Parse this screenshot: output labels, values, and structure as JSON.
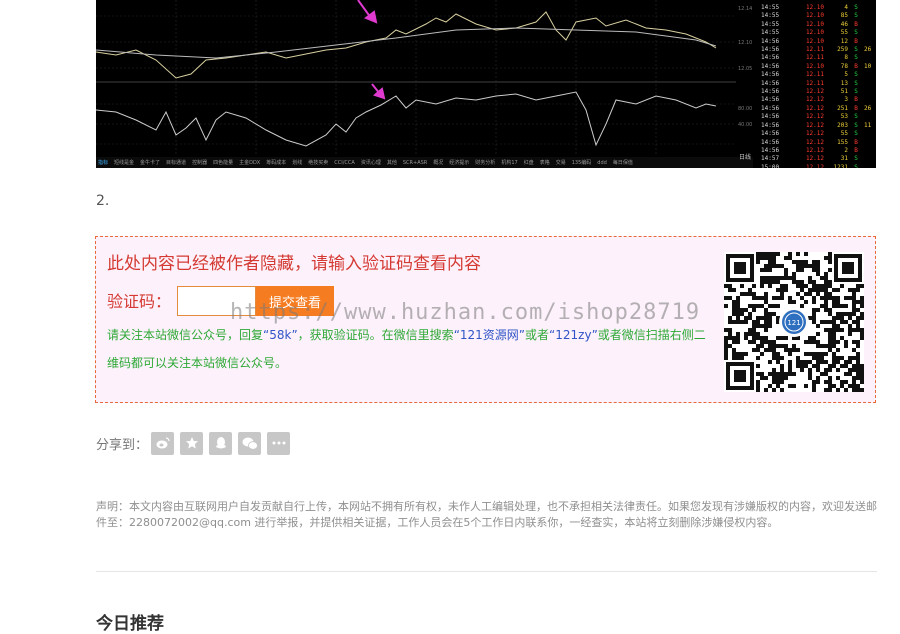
{
  "chart": {
    "times": [
      "14:55",
      "14:55",
      "14:55",
      "14:55",
      "14:56",
      "14:56",
      "14:56",
      "14:56",
      "14:56",
      "14:56",
      "14:56",
      "14:56",
      "14:56",
      "14:56",
      "14:56",
      "14:56",
      "14:56",
      "14:56",
      "14:57",
      "15:00"
    ],
    "prices": [
      "12.10",
      "12.10",
      "12.10",
      "12.10",
      "12.10",
      "12.11",
      "12.11",
      "12.10",
      "12.11",
      "12.11",
      "12.12",
      "12.12",
      "12.12",
      "12.12",
      "12.12",
      "12.12",
      "12.12",
      "12.12",
      "12.12",
      "12.12"
    ],
    "volumes": [
      "4",
      "85",
      "46",
      "55",
      "12",
      "259",
      "8",
      "78",
      "5",
      "13",
      "51",
      "3",
      "251",
      "53",
      "203",
      "55",
      "155",
      "2",
      "31",
      "1231"
    ],
    "directions": [
      "S",
      "S",
      "B",
      "S",
      "B",
      "S",
      "S",
      "B",
      "S",
      "S",
      "S",
      "B",
      "B",
      "S",
      "S",
      "S",
      "B",
      "B",
      "S",
      "S"
    ],
    "extra": [
      "",
      "",
      "",
      "",
      "",
      "26",
      "",
      "10",
      "",
      "",
      "",
      "",
      "26",
      "",
      "11",
      "",
      "",
      "",
      "",
      ""
    ],
    "tabs": [
      "指标",
      "短线是金",
      "金牛卡了",
      "目标通道",
      "控制器",
      "四色能量",
      "主金DDX",
      "筹码成本",
      "划线",
      "绝技买卖",
      "CCI/CCA",
      "资讯心理",
      "其他",
      "SCR+ASR",
      "概况",
      "经济提示",
      "财务分析",
      "机构17",
      "红盘",
      "表格",
      "交易",
      "135编码",
      "ddd",
      "每日保值"
    ],
    "side_label": "日线"
  },
  "step_number": "2.",
  "hidden_box": {
    "title": "此处内容已经被作者隐藏，请输入验证码查看内容",
    "code_label": "验证码：",
    "code_input_value": "",
    "submit_label": "提交查看",
    "instruction": {
      "part1": "请关注本站微信公众号，回复",
      "keyword": "“58k”",
      "part2": "，获取验证码。在微信里搜索",
      "site_name": "“121资源网”",
      "part3": "或者",
      "site_id": "“121zy”",
      "part4": "或者微信扫描右侧二维码都可以关注本站微信公众号。"
    },
    "qr_center_text": "121"
  },
  "watermark": "https://www.huzhan.com/ishop28719",
  "share": {
    "label": "分享到：",
    "icons": [
      "weibo-icon",
      "star-icon",
      "qq-icon",
      "wechat-icon",
      "more-icon"
    ]
  },
  "disclaimer": "声明：本文内容由互联网用户自发贡献自行上传，本网站不拥有所有权，未作人工编辑处理，也不承担相关法律责任。如果您发现有涉嫌版权的内容，欢迎发送邮件至：2280072002@qq.com 进行举报，并提供相关证据，工作人员会在5个工作日内联系你，一经查实，本站将立刻删除涉嫌侵权内容。",
  "recommend_heading": "今日推荐",
  "colors": {
    "accent_red": "#d43a33",
    "submit_orange": "#f57c21",
    "instruction_green": "#2ea836",
    "highlight_blue": "#3054c7",
    "box_background": "#fdf2fb"
  }
}
